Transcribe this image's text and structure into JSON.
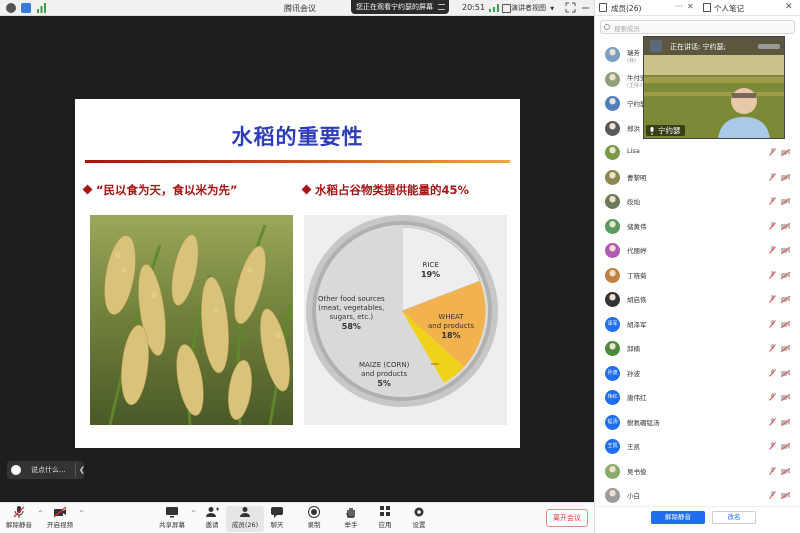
{
  "titlebar": {
    "title": "腾讯会议",
    "banner": "您正在观看宁约瑟的屏幕",
    "time": "20:51",
    "view_label": "演讲者视图"
  },
  "slide": {
    "title": "水稻的重要性",
    "bullet1": "“民以食为天，食以米为先”",
    "bullet2": "水稻占谷物类提供能量的45%",
    "pie": {
      "rice_label": "RICE",
      "rice_pct": "19%",
      "wheat_label": "WHEAT\nand products",
      "wheat_pct": "18%",
      "maize_label": "MAIZE (CORN)\nand products",
      "maize_pct": "5%",
      "other_label": "Other food sources\n(meat, vegetables,\nsugars, etc.)",
      "other_pct": "58%"
    }
  },
  "chat": {
    "placeholder": "说点什么..."
  },
  "toolbar": {
    "mute": "解除静音",
    "video": "开启视频",
    "share": "共享屏幕",
    "invite": "邀请",
    "members": "成员(26)",
    "chat": "聊天",
    "record": "录制",
    "hand": "举手",
    "apps": "应用",
    "settings": "设置",
    "leave": "离开会议"
  },
  "panel": {
    "title": "成员(26)",
    "notes": "个人笔记",
    "search_placeholder": "搜索成员",
    "speaking": "正在讲话: 宁约瑟;",
    "video_name": "宁约瑟",
    "mute_all": "解除静音",
    "rename": "改名",
    "members": [
      {
        "name": "瑞芳",
        "sub": "(我)",
        "avatar": "photo",
        "color": "#7a9ec0"
      },
      {
        "name": "牛付安",
        "sub": "(主持人)",
        "avatar": "photo",
        "color": "#8fa07a"
      },
      {
        "name": "宁约瑟",
        "sub": "",
        "avatar": "photo",
        "color": "#4f7fbf"
      },
      {
        "name": "郑洪",
        "sub": "",
        "avatar": "photo",
        "color": "#5a5a5a"
      },
      {
        "name": "Lisa",
        "sub": "",
        "avatar": "photo",
        "color": "#7a9a4a"
      },
      {
        "name": "曹黎明",
        "sub": "",
        "avatar": "photo",
        "color": "#8a8a50"
      },
      {
        "name": "段灿",
        "sub": "",
        "avatar": "photo",
        "color": "#6a7a5a"
      },
      {
        "name": "储黄伟",
        "sub": "",
        "avatar": "photo",
        "color": "#5a9a5a"
      },
      {
        "name": "代丽婷",
        "sub": "",
        "avatar": "photo",
        "color": "#b05ab0"
      },
      {
        "name": "丁晓菊",
        "sub": "",
        "avatar": "photo",
        "color": "#c08040"
      },
      {
        "name": "胡启恢",
        "sub": "",
        "avatar": "photo",
        "color": "#333333"
      },
      {
        "name": "胡泽军",
        "sub": "",
        "avatar": "text",
        "initials": "泽军",
        "color": "#1f6ef0"
      },
      {
        "name": "邱楠",
        "sub": "",
        "avatar": "photo",
        "color": "#4a8a3a"
      },
      {
        "name": "孙波",
        "sub": "",
        "avatar": "text",
        "initials": "孙波",
        "color": "#1f6ef0"
      },
      {
        "name": "唐伟红",
        "sub": "",
        "avatar": "text",
        "initials": "伟红",
        "color": "#1f6ef0"
      },
      {
        "name": "鲵氡硼锰汤",
        "sub": "",
        "avatar": "text",
        "initials": "锰汤",
        "color": "#1f6ef0"
      },
      {
        "name": "王凯",
        "sub": "",
        "avatar": "text",
        "initials": "王凯",
        "color": "#1f6ef0"
      },
      {
        "name": "吴书俊",
        "sub": "",
        "avatar": "photo",
        "color": "#8aaa6a"
      },
      {
        "name": "小白",
        "sub": "",
        "avatar": "photo",
        "color": "#9a9aa0"
      }
    ]
  },
  "colors": {
    "accent": "#1f6ef0",
    "slide_title": "#2e3dbb",
    "bullet": "#a71515",
    "leave": "#dd3333",
    "muted_icon": "#e05050"
  }
}
